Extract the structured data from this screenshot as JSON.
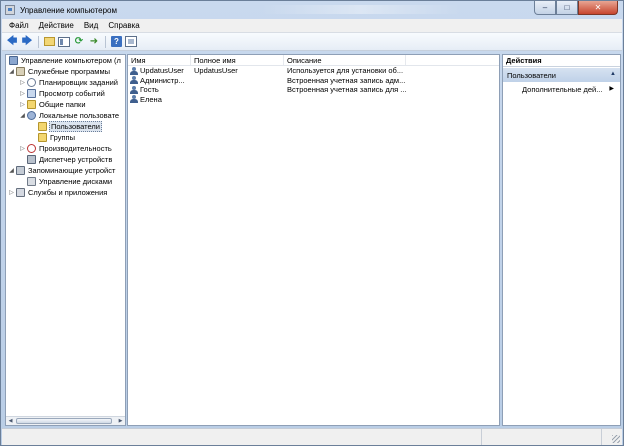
{
  "window": {
    "title": "Управление компьютером",
    "buttons": {
      "minimize": "–",
      "maximize": "□",
      "close": "✕"
    }
  },
  "menubar": {
    "items": [
      "Файл",
      "Действие",
      "Вид",
      "Справка"
    ]
  },
  "toolbar": {
    "icons": [
      "back-icon",
      "forward-icon",
      "up-folder-icon",
      "show-hide-tree-icon",
      "refresh-icon",
      "export-list-icon",
      "help-icon",
      "properties-icon"
    ]
  },
  "tree": {
    "root": "Управление компьютером (л",
    "items": [
      {
        "label": "Служебные программы",
        "level": 1,
        "expander": "◢",
        "icon": "tools-icon"
      },
      {
        "label": "Планировщик заданий",
        "level": 2,
        "expander": "▷",
        "icon": "clock-icon"
      },
      {
        "label": "Просмотр событий",
        "level": 2,
        "expander": "▷",
        "icon": "event-log-icon"
      },
      {
        "label": "Общие папки",
        "level": 2,
        "expander": "▷",
        "icon": "shared-folder-icon"
      },
      {
        "label": "Локальные пользовате",
        "level": 2,
        "expander": "◢",
        "icon": "local-users-icon"
      },
      {
        "label": "Пользователи",
        "level": 3,
        "expander": "",
        "icon": "folder-icon",
        "selected": true
      },
      {
        "label": "Группы",
        "level": 3,
        "expander": "",
        "icon": "folder-icon"
      },
      {
        "label": "Производительность",
        "level": 2,
        "expander": "▷",
        "icon": "performance-icon"
      },
      {
        "label": "Диспетчер устройств",
        "level": 2,
        "expander": "",
        "icon": "device-manager-icon"
      },
      {
        "label": "Запоминающие устройст",
        "level": 1,
        "expander": "◢",
        "icon": "storage-icon"
      },
      {
        "label": "Управление дисками",
        "level": 2,
        "expander": "",
        "icon": "disk-icon"
      },
      {
        "label": "Службы и приложения",
        "level": 1,
        "expander": "▷",
        "icon": "services-icon"
      }
    ]
  },
  "list": {
    "columns": [
      "Имя",
      "Полное имя",
      "Описание"
    ],
    "rows": [
      {
        "name": "UpdatusUser",
        "full_name": "UpdatusUser",
        "description": "Используется для установки об..."
      },
      {
        "name": "Администр...",
        "full_name": "",
        "description": "Встроенная учетная запись адм..."
      },
      {
        "name": "Гость",
        "full_name": "",
        "description": "Встроенная учетная запись для ..."
      },
      {
        "name": "Елена",
        "full_name": "",
        "description": ""
      }
    ]
  },
  "actions": {
    "header": "Действия",
    "section": "Пользователи",
    "section_caret": "▲",
    "item": "Дополнительные дей...",
    "item_caret": "▶"
  },
  "scroll": {
    "left": "◀",
    "right": "▶"
  }
}
